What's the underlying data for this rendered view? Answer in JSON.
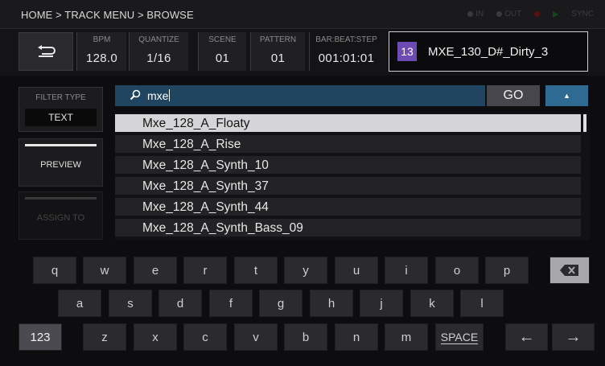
{
  "header": {
    "breadcrumb": "HOME > TRACK MENU > BROWSE",
    "indicators": [
      {
        "label": "IN",
        "icon": "dot"
      },
      {
        "label": "OUT",
        "icon": "dot"
      },
      {
        "label": "",
        "icon": "rec-dot"
      },
      {
        "label": "",
        "icon": "play"
      },
      {
        "label": "SYNC",
        "icon": ""
      }
    ]
  },
  "status": {
    "bpm": {
      "label": "BPM",
      "value": "128.0"
    },
    "quantize": {
      "label": "QUANTIZE",
      "value": "1/16"
    },
    "scene": {
      "label": "SCENE",
      "value": "01"
    },
    "pattern": {
      "label": "PATTERN",
      "value": "01"
    },
    "position": {
      "label": "BAR:BEAT:STEP",
      "value": "001:01:01"
    },
    "track": {
      "number": "13",
      "name": "MXE_130_D#_Dirty_3",
      "color": "#6e4bb2"
    }
  },
  "left_panel": {
    "filter_label": "FILTER TYPE",
    "filter_value": "TEXT",
    "preview_label": "PREVIEW",
    "assign_label": "ASSIGN TO"
  },
  "search": {
    "query": "mxe",
    "go_label": "GO",
    "up_label": "▲"
  },
  "results": [
    {
      "name": "Mxe_128_A_Floaty",
      "selected": true
    },
    {
      "name": "Mxe_128_A_Rise",
      "selected": false
    },
    {
      "name": "Mxe_128_A_Synth_10",
      "selected": false
    },
    {
      "name": "Mxe_128_A_Synth_37",
      "selected": false
    },
    {
      "name": "Mxe_128_A_Synth_44",
      "selected": false
    },
    {
      "name": "Mxe_128_A_Synth_Bass_09",
      "selected": false
    }
  ],
  "keyboard": {
    "row1": [
      "q",
      "w",
      "e",
      "r",
      "t",
      "y",
      "u",
      "i",
      "o",
      "p"
    ],
    "row2": [
      "a",
      "s",
      "d",
      "f",
      "g",
      "h",
      "j",
      "k",
      "l"
    ],
    "row3": [
      "z",
      "x",
      "c",
      "v",
      "b",
      "n",
      "m"
    ],
    "numbers_label": "123",
    "space_label": "SPACE",
    "left_arrow": "←",
    "right_arrow": "→"
  }
}
